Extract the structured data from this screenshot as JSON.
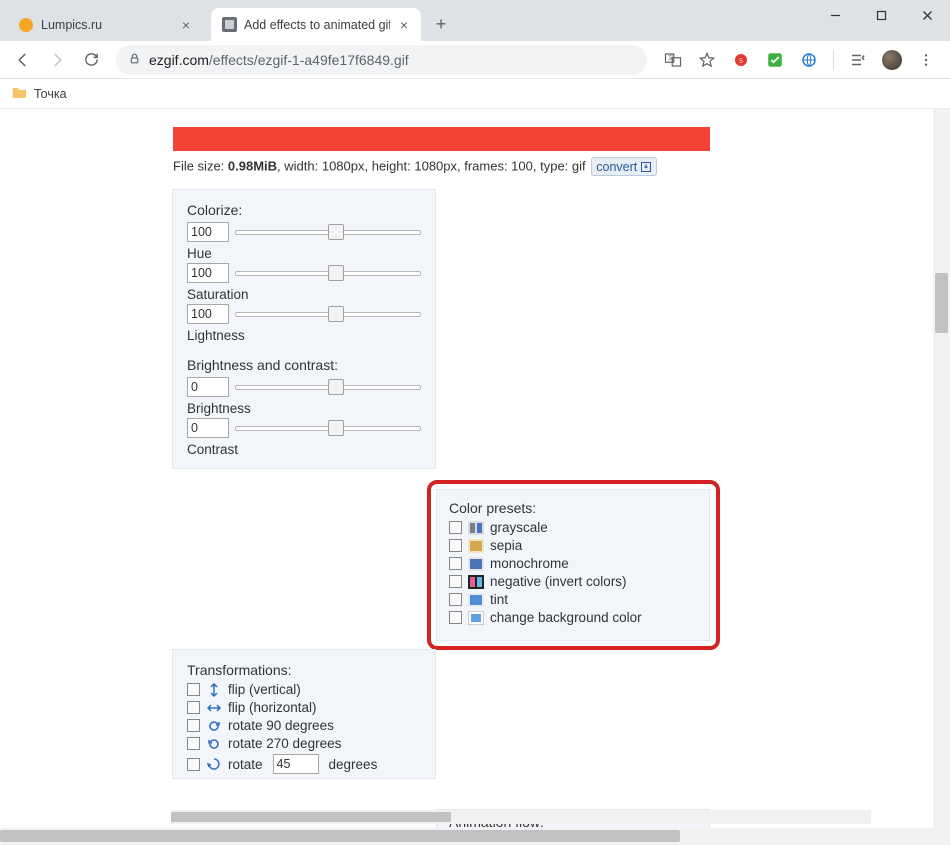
{
  "tabs": [
    {
      "title": "Lumpics.ru"
    },
    {
      "title": "Add effects to animated gifs - gif..."
    }
  ],
  "url": {
    "domain": "ezgif.com",
    "path": "/effects/ezgif-1-a49fe17f6849.gif"
  },
  "bookmark_folder": "Точка",
  "fileinfo": {
    "prefix": "File size: ",
    "size": "0.98MiB",
    "rest": ", width: 1080px, height: 1080px, frames: 100, type: gif",
    "convert_label": "convert"
  },
  "colorize": {
    "section_title": "Colorize:",
    "hue_label": "Hue",
    "saturation_label": "Saturation",
    "lightness_label": "Lightness",
    "bc_title": "Brightness and contrast:",
    "brightness_label": "Brightness",
    "contrast_label": "Contrast",
    "hue_value": "100",
    "saturation_value": "100",
    "lightness_value": "100",
    "brightness_value": "0",
    "contrast_value": "0"
  },
  "presets": {
    "title": "Color presets:",
    "items": [
      "grayscale",
      "sepia",
      "monochrome",
      "negative (invert colors)",
      "tint",
      "change background color"
    ]
  },
  "transform": {
    "title": "Transformations:",
    "flip_v": "flip (vertical)",
    "flip_h": "flip (horizontal)",
    "rot90": "rotate 90 degrees",
    "rot270": "rotate 270 degrees",
    "rot_custom_prefix": "rotate",
    "rot_custom_value": "45",
    "rot_custom_suffix": "degrees"
  },
  "animflow": {
    "title": "Animation flow:"
  }
}
